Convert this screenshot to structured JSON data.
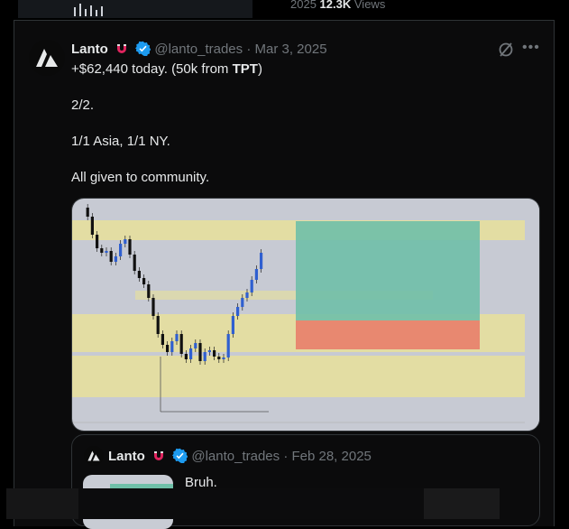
{
  "top": {
    "views_count": "12.3K",
    "views_label": "Views",
    "partial_number": "2025"
  },
  "post": {
    "name": "Lanto",
    "handle": "@lanto_trades",
    "date": "Mar 3, 2025",
    "line1_prefix": "+$62,440 today. (50k from ",
    "line1_bold": "TPT",
    "line1_suffix": ")",
    "line2": "2/2.",
    "line3": "1/1 Asia, 1/1 NY.",
    "line4": "All given to community."
  },
  "quote": {
    "name": "Lanto",
    "handle": "@lanto_trades",
    "date": "Feb 28, 2025",
    "text": "Bruh."
  },
  "colors": {
    "verified": "#1d9bf0",
    "magnet": "#e0245e",
    "candle_up": "#2f5fd0",
    "candle_down": "#111111",
    "zone_yellow": "#e8e19a",
    "tp_green": "#6fbfa8",
    "sl_red": "#e8836e"
  },
  "icons": [
    "lanto-logo-icon",
    "magnet-icon",
    "verified-icon",
    "grok-icon",
    "more-icon"
  ]
}
